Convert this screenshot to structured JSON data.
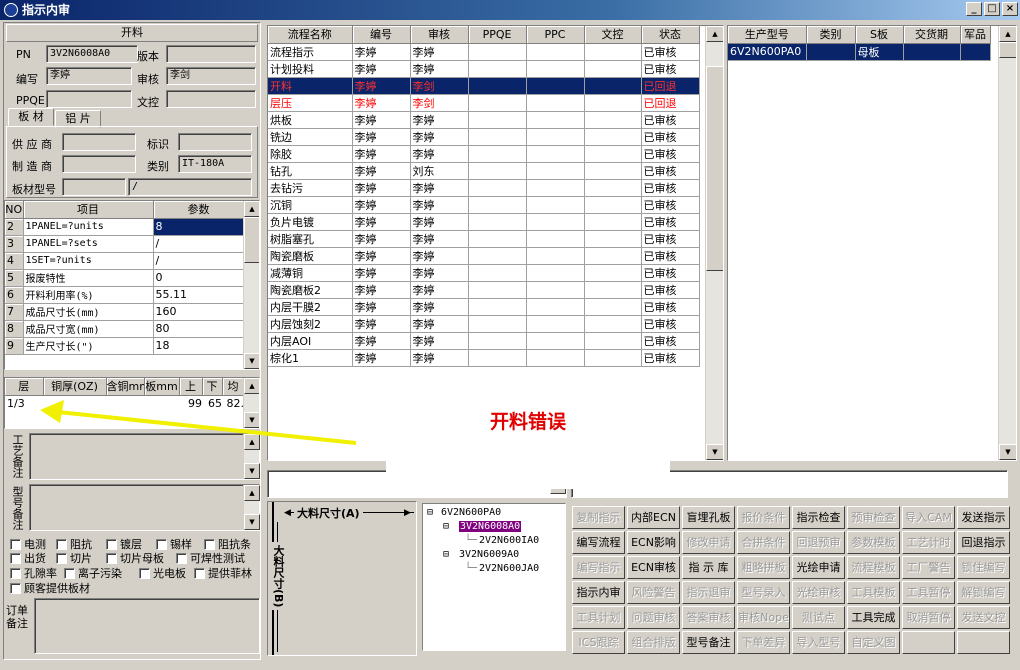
{
  "window": {
    "title": "指示内审",
    "min_icon": "minimize-icon",
    "max_icon": "maximize-icon",
    "close_icon": "close-icon"
  },
  "left": {
    "section_title": "开料",
    "pn_label": "PN",
    "pn_value": "3V2N6008A0",
    "version_label": "版本",
    "version_value": "",
    "editor_label": "编写",
    "editor_value": "李婷",
    "reviewer_label": "审核",
    "reviewer_value": "李剑",
    "ppqe_label": "PPQE",
    "ppqe_value": "",
    "control_label": "文控",
    "control_value": "",
    "tabs": [
      "板 材",
      "铝 片"
    ],
    "supplier_label": "供 应 商",
    "supplier_value": "",
    "mark_label": "标识",
    "mark_value": "",
    "maker_label": "制 造 商",
    "maker_value": "",
    "category_label": "类别",
    "category_value": "IT-180A",
    "model_label": "板材型号",
    "model_value": "",
    "model_value2": "/",
    "params_headers": [
      "NO",
      "项目",
      "参数"
    ],
    "params_rows": [
      [
        "2",
        "1PANEL=?units",
        "8"
      ],
      [
        "3",
        "1PANEL=?sets",
        "/"
      ],
      [
        "4",
        "1SET=?units",
        "/"
      ],
      [
        "5",
        "报废特性",
        "0"
      ],
      [
        "6",
        "开料利用率(%)",
        "55.11"
      ],
      [
        "7",
        "成品尺寸长(mm)",
        "160"
      ],
      [
        "8",
        "成品尺寸宽(mm)",
        "80"
      ],
      [
        "9",
        "生产尺寸长(\")",
        "18"
      ]
    ],
    "layer_headers": [
      "层",
      "铜厚(OZ)",
      "含铜mm",
      "板mm",
      "上",
      "下",
      "均"
    ],
    "layer_rows": [
      [
        "1/3",
        "",
        "",
        "",
        "99",
        "65",
        "82."
      ]
    ],
    "craft_note_label": "工艺备注",
    "model_note_label": "型号备注",
    "checkboxes": [
      "电测",
      "阻抗",
      "镀层",
      "锡样",
      "阻抗条",
      "出货",
      "切片",
      "切片母板",
      "可焊性测试",
      "孔隙率",
      "离子污染",
      "光电板",
      "提供菲林",
      "顾客提供板材"
    ],
    "order_note_label": "订单备注"
  },
  "flow": {
    "headers": [
      "流程名称",
      "编号",
      "审核",
      "PPQE",
      "PPC",
      "文控",
      "状态"
    ],
    "rows": [
      [
        "流程指示",
        "李婷",
        "李婷",
        "",
        "",
        "",
        "已审核"
      ],
      [
        "计划投料",
        "李婷",
        "李婷",
        "",
        "",
        "",
        "已审核"
      ],
      [
        "开料",
        "李婷",
        "李剑",
        "",
        "",
        "",
        "已回退"
      ],
      [
        "层压",
        "李婷",
        "李剑",
        "",
        "",
        "",
        "已回退"
      ],
      [
        "烘板",
        "李婷",
        "李婷",
        "",
        "",
        "",
        "已审核"
      ],
      [
        "铣边",
        "李婷",
        "李婷",
        "",
        "",
        "",
        "已审核"
      ],
      [
        "除胶",
        "李婷",
        "李婷",
        "",
        "",
        "",
        "已审核"
      ],
      [
        "钻孔",
        "李婷",
        "刘东",
        "",
        "",
        "",
        "已审核"
      ],
      [
        "去钻污",
        "李婷",
        "李婷",
        "",
        "",
        "",
        "已审核"
      ],
      [
        "沉铜",
        "李婷",
        "李婷",
        "",
        "",
        "",
        "已审核"
      ],
      [
        "负片电镀",
        "李婷",
        "李婷",
        "",
        "",
        "",
        "已审核"
      ],
      [
        "树脂塞孔",
        "李婷",
        "李婷",
        "",
        "",
        "",
        "已审核"
      ],
      [
        "陶瓷磨板",
        "李婷",
        "李婷",
        "",
        "",
        "",
        "已审核"
      ],
      [
        "减薄铜",
        "李婷",
        "李婷",
        "",
        "",
        "",
        "已审核"
      ],
      [
        "陶瓷磨板2",
        "李婷",
        "李婷",
        "",
        "",
        "",
        "已审核"
      ],
      [
        "内层干膜2",
        "李婷",
        "李婷",
        "",
        "",
        "",
        "已审核"
      ],
      [
        "内层蚀刻2",
        "李婷",
        "李婷",
        "",
        "",
        "",
        "已审核"
      ],
      [
        "内层AOI",
        "李婷",
        "李婷",
        "",
        "",
        "",
        "已审核"
      ],
      [
        "棕化1",
        "李婷",
        "李婷",
        "",
        "",
        "",
        "已审核"
      ]
    ]
  },
  "product": {
    "headers": [
      "生产型号",
      "类别",
      "S板",
      "交货期",
      "军品"
    ],
    "rows": [
      [
        "6V2N600PA0",
        "",
        "母板",
        "",
        ""
      ]
    ]
  },
  "annotation": {
    "text": "开料错误"
  },
  "size_diagram": {
    "top_label": "大料尺寸(A)",
    "side_label": "大料尺寸(B)"
  },
  "tree": {
    "nodes": [
      "6V2N600PA0",
      "3V2N6008A0",
      "2V2N600IA0",
      "3V2N6009A0",
      "2V2N600JA0"
    ]
  },
  "buttons": [
    [
      "复制指示",
      "内部ECN",
      "盲埋孔板",
      "报价条件",
      "指示检查",
      "预审检查",
      "导入CAM",
      "发送指示"
    ],
    [
      "编写流程",
      "ECN影响",
      "修改申请",
      "合拼条件",
      "回退预审",
      "参数模板",
      "工艺计时",
      "回退指示"
    ],
    [
      "编写指示",
      "ECN审核",
      "指 示 库",
      "粗略拼板",
      "光绘申请",
      "流程模板",
      "工厂警告",
      "锁住编写"
    ],
    [
      "指示内审",
      "风险警告",
      "指示退审",
      "型号录入",
      "光绘审核",
      "工具模板",
      "工具暂停",
      "解锁编写"
    ],
    [
      "工具计划",
      "问题审核",
      "答案审核",
      "审核Nope",
      "测试点",
      "工具完成",
      "取消暂停",
      "发送文控"
    ],
    [
      "ICS跟踪",
      "组合排版",
      "型号备注",
      "下单差异",
      "导入型号",
      "自定义图",
      "",
      ""
    ]
  ],
  "buttons_disabled": [
    [
      true,
      false,
      false,
      true,
      false,
      true,
      true,
      false
    ],
    [
      false,
      false,
      true,
      true,
      true,
      true,
      true,
      false
    ],
    [
      true,
      false,
      false,
      true,
      false,
      true,
      true,
      true
    ],
    [
      false,
      true,
      true,
      true,
      true,
      true,
      true,
      true
    ],
    [
      true,
      true,
      true,
      true,
      true,
      false,
      true,
      true
    ],
    [
      true,
      true,
      false,
      true,
      true,
      true,
      true,
      true
    ]
  ]
}
